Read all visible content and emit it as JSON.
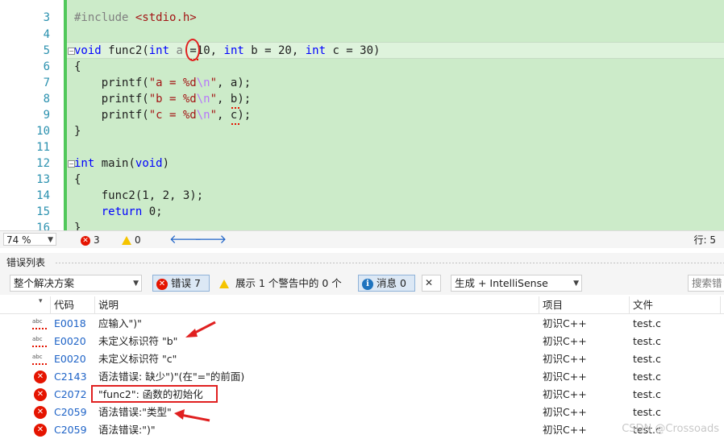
{
  "editor": {
    "lines": [
      {
        "num": "3",
        "text": "#include <stdio.h>"
      },
      {
        "num": "4",
        "text": ""
      },
      {
        "num": "5",
        "text": "void func2(int a = 10, int b = 20, int c = 30)"
      },
      {
        "num": "6",
        "text": "{"
      },
      {
        "num": "7",
        "text": "    printf(\"a = %d\\n\", a);"
      },
      {
        "num": "8",
        "text": "    printf(\"b = %d\\n\", b);"
      },
      {
        "num": "9",
        "text": "    printf(\"c = %d\\n\", c);"
      },
      {
        "num": "10",
        "text": "}"
      },
      {
        "num": "11",
        "text": ""
      },
      {
        "num": "12",
        "text": "int main(void)"
      },
      {
        "num": "13",
        "text": "{"
      },
      {
        "num": "14",
        "text": "    func2(1, 2, 3);"
      },
      {
        "num": "15",
        "text": "    return 0;"
      },
      {
        "num": "16",
        "text": "}"
      }
    ],
    "tokens": {
      "include": "#include",
      "stdio": "<stdio.h>",
      "void": "void",
      "func2": "func2",
      "int": "int",
      "open": "(",
      "a_param": "a",
      "eq": "=",
      "rest5": "10,",
      "b_part": "b = 20,",
      "c_part": "c = 30)",
      "brace_open": "{",
      "brace_close": "}",
      "printf": "printf(",
      "str_a": "\"a = %d",
      "str_b": "\"b = %d",
      "str_c": "\"c = %d",
      "esc": "\\n",
      "q": "\"",
      "arg_a": ", a);",
      "arg_b_pre": ", ",
      "arg_b": "b",
      "arg_c": "c",
      "arg_end": ");",
      "main": "main(",
      "void_kw": "void",
      "close_paren": ")",
      "call": "func2(1, 2, 3);",
      "return": "return",
      "ret_val": " 0;"
    }
  },
  "status": {
    "zoom": "74 %",
    "errors": "3",
    "warnings": "0",
    "line": "行: 5"
  },
  "error_list": {
    "title": "错误列表",
    "scope": "整个解决方案",
    "errors_btn": "错误 7",
    "warnings_text": "展示 1 个警告中的 0 个",
    "messages_btn": "消息 0",
    "build_filter": "生成 + IntelliSense",
    "search_placeholder": "搜索错",
    "columns": [
      "代码",
      "说明",
      "项目",
      "文件"
    ],
    "rows": [
      {
        "kind": "intellisense",
        "code": "E0018",
        "desc": "应输入\")\"",
        "project": "初识C++",
        "file": "test.c"
      },
      {
        "kind": "intellisense",
        "code": "E0020",
        "desc": "未定义标识符 \"b\"",
        "project": "初识C++",
        "file": "test.c"
      },
      {
        "kind": "intellisense",
        "code": "E0020",
        "desc": "未定义标识符 \"c\"",
        "project": "初识C++",
        "file": "test.c"
      },
      {
        "kind": "error",
        "code": "C2143",
        "desc": "语法错误: 缺少\")\"(在\"=\"的前面)",
        "project": "初识C++",
        "file": "test.c"
      },
      {
        "kind": "error",
        "code": "C2072",
        "desc": "\"func2\": 函数的初始化",
        "project": "初识C++",
        "file": "test.c"
      },
      {
        "kind": "error",
        "code": "C2059",
        "desc": "语法错误:\"类型\"",
        "project": "初识C++",
        "file": "test.c"
      },
      {
        "kind": "error",
        "code": "C2059",
        "desc": "语法错误:\")\"",
        "project": "初识C++",
        "file": "test.c"
      }
    ]
  },
  "watermark": "CSDN @Crossoads",
  "colors": {
    "code_bg": "#ccebc9",
    "change_bar": "#50c85a",
    "error_red": "#e51400",
    "keyword_blue": "#0000ff",
    "string_red": "#a31515",
    "annotation_red": "#e02020"
  }
}
